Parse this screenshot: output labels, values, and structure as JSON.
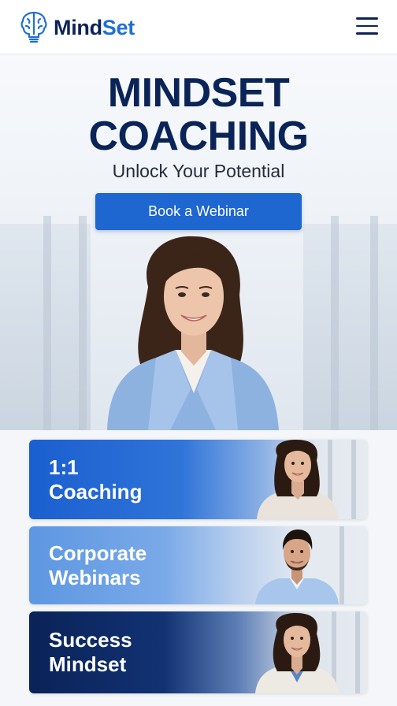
{
  "header": {
    "logo_text_1": "Mind",
    "logo_text_2": "Set",
    "logo_icon": "brain-lightbulb-icon",
    "menu_icon": "hamburger-menu-icon"
  },
  "hero": {
    "title_line1": "MINDSET",
    "title_line2": "COACHING",
    "subtitle": "Unlock Your Potential",
    "cta_label": "Book a Webinar",
    "image": "smiling female coach in light blue blazer, office background"
  },
  "services": [
    {
      "line1": "1:1",
      "line2": "Coaching",
      "image": "female coach portrait"
    },
    {
      "line1": "Corporate",
      "line2": "Webinars",
      "image": "male coach portrait"
    },
    {
      "line1": "Success",
      "line2": "Mindset",
      "image": "female coach portrait"
    }
  ],
  "colors": {
    "navy": "#0b2457",
    "brand_blue": "#1e66d0",
    "light_blue": "#6fa3e6",
    "dark_navy": "#0a2358"
  }
}
